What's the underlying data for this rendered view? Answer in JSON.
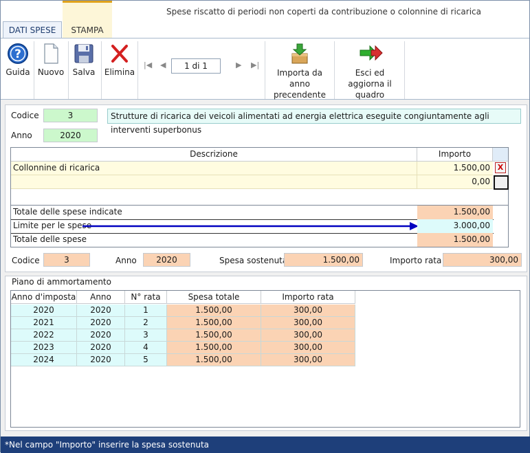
{
  "window": {
    "title": "Spese riscatto di periodi non coperti da contribuzione o colonnine di ricarica"
  },
  "tabs": [
    {
      "label": "DATI SPESE"
    },
    {
      "label": "STAMPA"
    }
  ],
  "toolbar": {
    "guida": "Guida",
    "nuovo": "Nuovo",
    "salva": "Salva",
    "elimina": "Elimina",
    "page": "1 di 1",
    "importa": "Importa da anno precendente",
    "esci": "Esci ed aggiorna il quadro"
  },
  "header": {
    "codice_label": "Codice",
    "codice": "3",
    "anno_label": "Anno",
    "anno": "2020",
    "descrizione": "Strutture di ricarica dei veicoli alimentati ad energia elettrica eseguite congiuntamente agli interventi superbonus"
  },
  "expenses": {
    "col_desc": "Descrizione",
    "col_importo": "Importo",
    "rows": [
      {
        "desc": "Collonnine di ricarica",
        "importo": "1.500,00"
      },
      {
        "desc": "",
        "importo": "0,00"
      }
    ],
    "totale_indicate_label": "Totale delle spese indicate",
    "totale_indicate": "1.500,00",
    "limite_label": "Limite per le spese",
    "limite": "3.000,00",
    "totale_label": "Totale delle spese",
    "totale": "1.500,00"
  },
  "summary": {
    "codice_label": "Codice",
    "codice": "3",
    "anno_label": "Anno",
    "anno": "2020",
    "spesa_label": "Spesa sostenuta",
    "spesa": "1.500,00",
    "rata_label": "Importo rata",
    "rata": "300,00"
  },
  "piano": {
    "title": "Piano di ammortamento",
    "headers": [
      "Anno d'imposta",
      "Anno",
      "N° rata",
      "Spesa totale",
      "Importo rata"
    ],
    "rows": [
      [
        "2020",
        "2020",
        "1",
        "1.500,00",
        "300,00"
      ],
      [
        "2021",
        "2020",
        "2",
        "1.500,00",
        "300,00"
      ],
      [
        "2022",
        "2020",
        "3",
        "1.500,00",
        "300,00"
      ],
      [
        "2023",
        "2020",
        "4",
        "1.500,00",
        "300,00"
      ],
      [
        "2024",
        "2020",
        "5",
        "1.500,00",
        "300,00"
      ]
    ]
  },
  "status": {
    "text": "*Nel campo \"Importo\" inserire la spesa sostenuta"
  },
  "colors": {
    "accent": "#1e3f7a",
    "green_field": "#ccf8cc",
    "peach_field": "#fbd3b4",
    "cyan_field": "#ddfbfb",
    "arrow": "#0000c0"
  }
}
